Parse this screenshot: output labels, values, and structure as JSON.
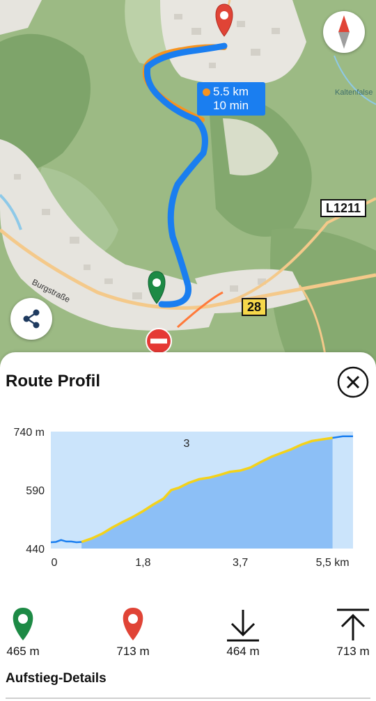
{
  "map": {
    "route_bubble": {
      "distance": "5.5 km",
      "duration": "10 min"
    },
    "road_labels": {
      "l1211": "L1211",
      "r28": "28"
    },
    "street_name": "Burgstraße",
    "place_name": "Kaltenfalse",
    "icons": {
      "compass": "compass-icon",
      "share": "share-icon",
      "start_marker": "start-marker-icon",
      "end_marker": "end-marker-icon",
      "no_entry": "no-entry-icon"
    },
    "colors": {
      "route": "#1a7ef0",
      "route_alt": "#f7931e",
      "start": "#1d8a45",
      "end": "#e04436"
    }
  },
  "sheet": {
    "title": "Route Profil",
    "close_icon": "close-icon",
    "details_title": "Aufstieg-Details",
    "stats": [
      {
        "icon": "start-marker-icon",
        "value": "465 m"
      },
      {
        "icon": "end-marker-icon",
        "value": "713 m"
      },
      {
        "icon": "arrow-down-icon",
        "value": "464 m"
      },
      {
        "icon": "arrow-up-to-top-icon",
        "value": "713 m"
      }
    ]
  },
  "chart_data": {
    "type": "area",
    "xlabel": "",
    "ylabel": "",
    "ylim": [
      440,
      740
    ],
    "xlim": [
      0,
      5.9
    ],
    "y_ticks": [
      "740 m",
      "590",
      "440"
    ],
    "x_ticks": [
      "0",
      "1,8",
      "3,7",
      "5,5 km"
    ],
    "x_tick_values": [
      0,
      1.8,
      3.7,
      5.5
    ],
    "annotation": "3",
    "annotation_x": 2.65,
    "annotation_y": 690,
    "highlight_range": [
      0.6,
      5.5
    ],
    "x": [
      0,
      0.1,
      0.2,
      0.3,
      0.4,
      0.5,
      0.6,
      0.8,
      1.0,
      1.2,
      1.4,
      1.6,
      1.8,
      2.0,
      2.2,
      2.35,
      2.5,
      2.7,
      2.9,
      3.1,
      3.3,
      3.5,
      3.7,
      3.9,
      4.1,
      4.3,
      4.5,
      4.7,
      4.9,
      5.1,
      5.3,
      5.5,
      5.7,
      5.9
    ],
    "y": [
      456,
      457,
      462,
      458,
      458,
      456,
      457,
      466,
      478,
      494,
      508,
      521,
      536,
      553,
      568,
      590,
      596,
      609,
      618,
      622,
      629,
      637,
      640,
      648,
      662,
      675,
      685,
      695,
      707,
      716,
      720,
      724,
      728,
      728
    ]
  }
}
